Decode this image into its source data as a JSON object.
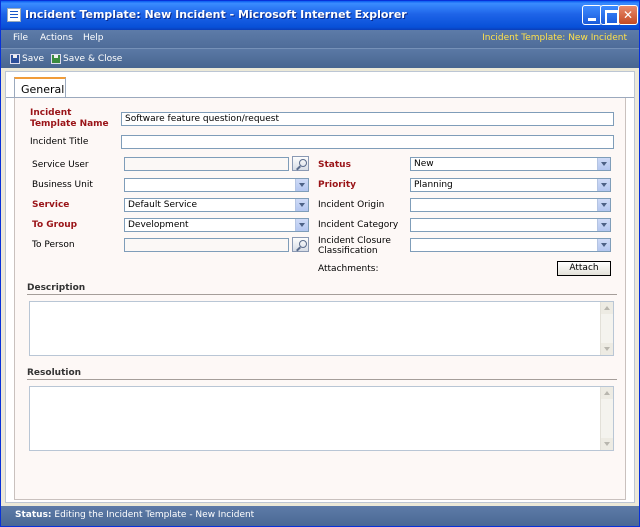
{
  "window": {
    "title": "Incident Template: New Incident - Microsoft Internet Explorer"
  },
  "menu": {
    "items": [
      "File",
      "Actions",
      "Help"
    ],
    "context": "Incident Template: New Incident"
  },
  "toolbar": {
    "save": "Save",
    "save_close": "Save & Close"
  },
  "tabs": [
    "General"
  ],
  "form": {
    "template_name_label": "Incident Template Name",
    "template_name_label_line1": "Incident",
    "template_name_label_line2": "Template Name",
    "template_name_value": "Software feature question/request",
    "title_label": "Incident Title",
    "title_value": "",
    "service_user_label": "Service User",
    "service_user_value": "",
    "business_unit_label": "Business Unit",
    "business_unit_value": "",
    "service_label": "Service",
    "service_value": "Default Service",
    "to_group_label": "To Group",
    "to_group_value": "Development",
    "to_person_label": "To Person",
    "to_person_value": "",
    "status_label": "Status",
    "status_value": "New",
    "priority_label": "Priority",
    "priority_value": "Planning",
    "origin_label": "Incident Origin",
    "origin_value": "",
    "category_label": "Incident Category",
    "category_value": "",
    "closure_label_line1": "Incident Closure",
    "closure_label_line2": "Classification",
    "closure_value": "",
    "attachments_label": "Attachments:",
    "attach_button": "Attach"
  },
  "sections": {
    "description": "Description",
    "resolution": "Resolution"
  },
  "status_bar": {
    "label": "Status:",
    "text": "Editing the Incident Template - New Incident"
  },
  "colors": {
    "required": "#9A1418",
    "accent_tab": "#F19C38",
    "bar": "#5D7BA8",
    "context_text": "#FFE14A"
  }
}
